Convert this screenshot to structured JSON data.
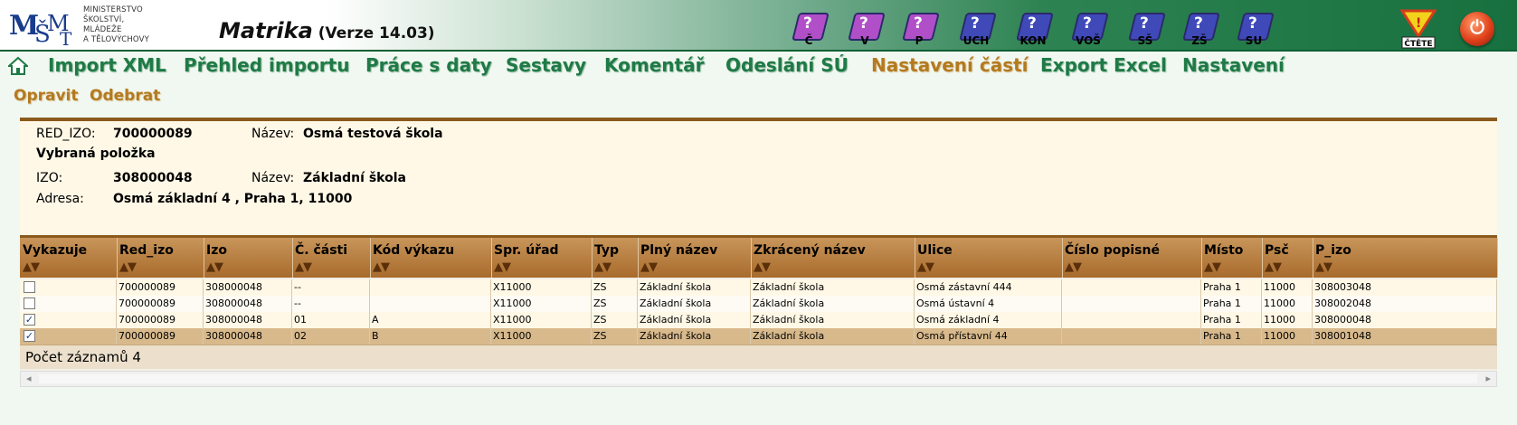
{
  "header": {
    "logo_text": [
      "MINISTERSTVO",
      "ŠKOLSTVÍ,",
      "MLÁDEŽE",
      "A TĚLOVÝCHOVY"
    ],
    "logo_mark": "MŠMT",
    "title": "Matrika",
    "version": "(Verze 14.03)",
    "icons": [
      {
        "label": "Č",
        "color": "#b04fc7"
      },
      {
        "label": "V",
        "color": "#b04fc7"
      },
      {
        "label": "P",
        "color": "#b04fc7"
      },
      {
        "label": "UCH",
        "color": "#3f49b8"
      },
      {
        "label": "KON",
        "color": "#3f49b8"
      },
      {
        "label": "VOŠ",
        "color": "#3f49b8"
      },
      {
        "label": "SŠ",
        "color": "#3f49b8"
      },
      {
        "label": "ZŠ",
        "color": "#3f49b8"
      },
      {
        "label": "SU",
        "color": "#3f49b8"
      }
    ],
    "cte_label": "ČTĚTE",
    "power_icon": "power-icon"
  },
  "nav": {
    "home_icon": "home-icon",
    "items": [
      "Import XML",
      "Přehled importu",
      "Práce s daty",
      "Sestavy",
      "Komentář",
      "Odeslání SÚ",
      "Nastavení částí",
      "Export Excel",
      "Nastavení"
    ],
    "active": "Nastavení částí"
  },
  "subnav": [
    "Opravit",
    "Odebrat"
  ],
  "info": {
    "red_izo_label": "RED_IZO:",
    "red_izo": "700000089",
    "nazev_label_1": "Název:",
    "nazev_1": "Osmá testová škola",
    "selected_label": "Vybraná položka",
    "izo_label": "IZO:",
    "izo": "308000048",
    "nazev_label_2": "Název:",
    "nazev_2": "Základní škola",
    "adresa_label": "Adresa:",
    "adresa": "Osmá základní 4 , Praha 1, 11000"
  },
  "table": {
    "sort_glyph": "▲▼",
    "columns": [
      "Vykazuje",
      "Red_izo",
      "Izo",
      "Č. části",
      "Kód výkazu",
      "Spr. úřad",
      "Typ",
      "Plný název",
      "Zkrácený název",
      "Ulice",
      "Číslo popisné",
      "Místo",
      "Psč",
      "P_izo"
    ],
    "rows": [
      {
        "checked": false,
        "cells": [
          "700000089",
          "308000048",
          "--",
          "",
          "X11000",
          "ZS",
          "Základní škola",
          "Základní škola",
          "Osmá zástavní 444",
          "",
          "Praha 1",
          "11000",
          "308003048"
        ]
      },
      {
        "checked": false,
        "cells": [
          "700000089",
          "308000048",
          "--",
          "",
          "X11000",
          "ZS",
          "Základní škola",
          "Základní škola",
          "Osmá ústavní 4",
          "",
          "Praha 1",
          "11000",
          "308002048"
        ]
      },
      {
        "checked": true,
        "cells": [
          "700000089",
          "308000048",
          "01",
          "A",
          "X11000",
          "ZS",
          "Základní škola",
          "Základní škola",
          "Osmá základní 4",
          "",
          "Praha 1",
          "11000",
          "308000048"
        ]
      },
      {
        "checked": true,
        "cells": [
          "700000089",
          "308000048",
          "02",
          "B",
          "X11000",
          "ZS",
          "Základní škola",
          "Základní škola",
          "Osmá přístavní 44",
          "",
          "Praha 1",
          "11000",
          "308001048"
        ]
      }
    ],
    "footer": "Počet záznamů 4"
  }
}
